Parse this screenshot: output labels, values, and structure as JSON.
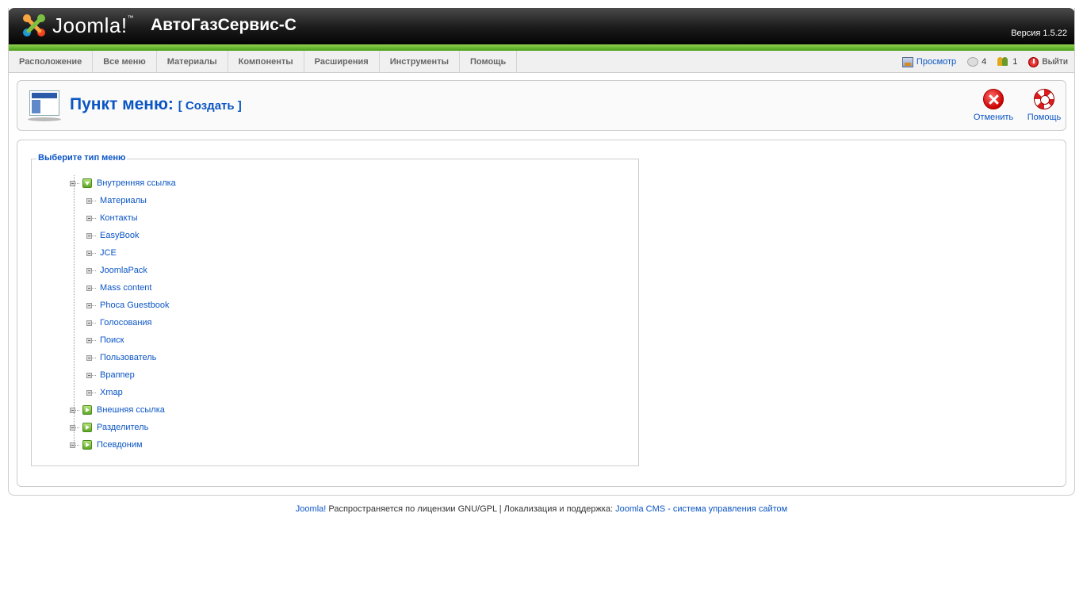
{
  "header": {
    "logo_text": "Joomla!",
    "logo_tm": "™",
    "site_name": "АвтоГазСервис-С",
    "version": "Версия 1.5.22"
  },
  "menu": {
    "items": [
      "Расположение",
      "Все меню",
      "Материалы",
      "Компоненты",
      "Расширения",
      "Инструменты",
      "Помощь"
    ]
  },
  "status": {
    "preview_label": "Просмотр",
    "messages_count": "4",
    "users_count": "1",
    "logout_label": "Выйти"
  },
  "toolbar": {
    "title": "Пункт меню:",
    "subtitle": "[ Создать ]",
    "cancel_label": "Отменить",
    "help_label": "Помощь"
  },
  "content": {
    "legend": "Выберите тип меню",
    "tree": {
      "internal": "Внутренняя ссылка",
      "children": [
        "Материалы",
        "Контакты",
        "EasyBook",
        "JCE",
        "JoomlaPack",
        "Mass content",
        "Phoca Guestbook",
        "Голосования",
        "Поиск",
        "Пользователь",
        "Враппер",
        "Xmap"
      ],
      "external": "Внешняя ссылка",
      "separator": "Разделитель",
      "alias": "Псевдоним"
    }
  },
  "footer": {
    "joomla_link": "Joomla!",
    "license_text": " Распространяется по лицензии GNU/GPL | Локализация и поддержка: ",
    "support_link": "Joomla CMS - система управления сайтом"
  },
  "colors": {
    "link": "#0b55c4",
    "header_bg": "#1a1a1a",
    "green_bar": "#6ab82e"
  }
}
